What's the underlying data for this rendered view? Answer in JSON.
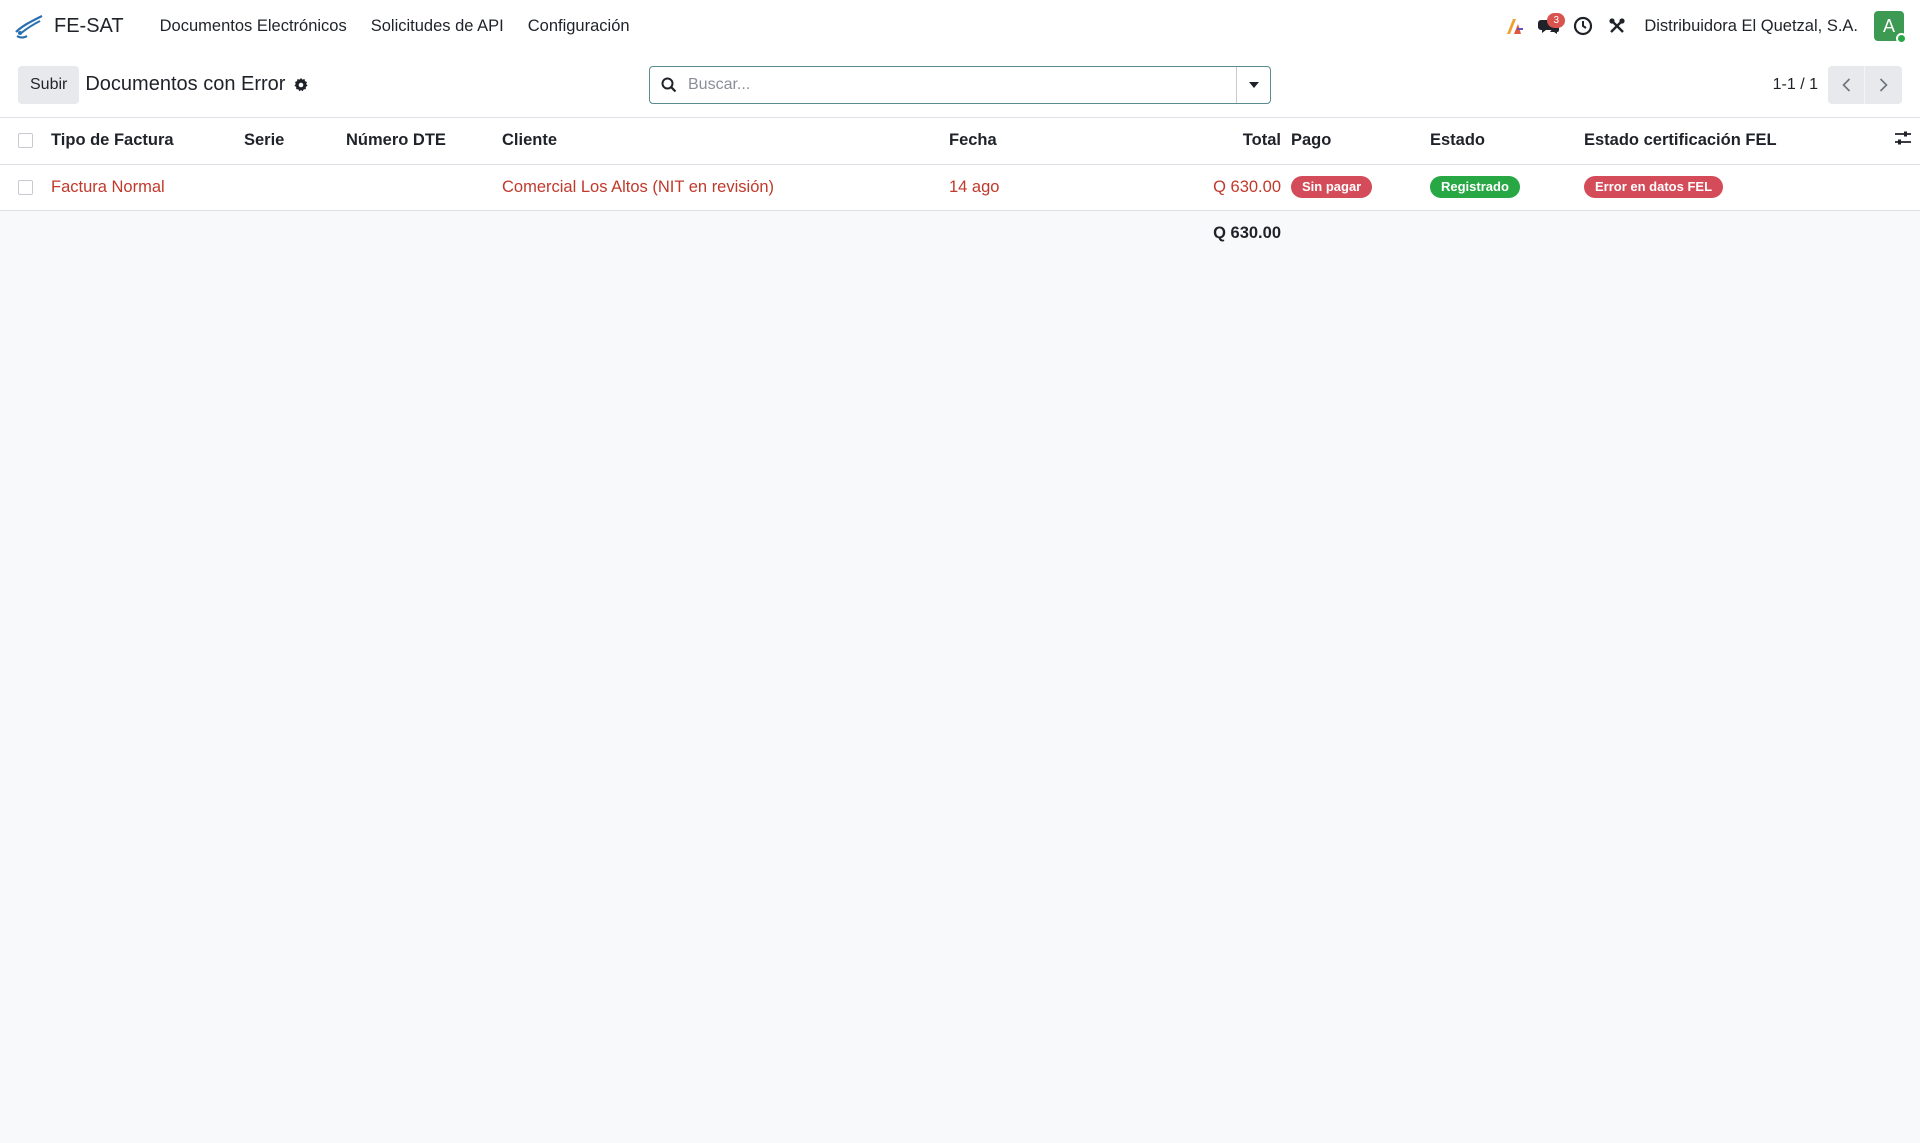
{
  "app": {
    "name": "FE-SAT"
  },
  "menu": [
    {
      "label": "Documentos Electrónicos"
    },
    {
      "label": "Solicitudes de API"
    },
    {
      "label": "Configuración"
    }
  ],
  "systray": {
    "messages_count": "3",
    "company": "Distribuidora El Quetzal, S.A.",
    "avatar_initial": "A"
  },
  "control": {
    "upload_label": "Subir",
    "title": "Documentos con Error",
    "search_placeholder": "Buscar...",
    "pager": "1-1 / 1"
  },
  "table": {
    "columns": {
      "tipo": "Tipo de Factura",
      "serie": "Serie",
      "numero": "Número DTE",
      "cliente": "Cliente",
      "fecha": "Fecha",
      "total": "Total",
      "pago": "Pago",
      "estado": "Estado",
      "fel": "Estado certificación FEL"
    },
    "rows": [
      {
        "tipo": "Factura Normal",
        "serie": "",
        "numero": "",
        "cliente": "Comercial Los Altos (NIT en revisión)",
        "fecha": "14 ago",
        "total": "Q 630.00",
        "pago": "Sin pagar",
        "estado": "Registrado",
        "fel": "Error en datos FEL"
      }
    ],
    "footer_total": "Q 630.00"
  },
  "colors": {
    "danger_text": "#c0392b",
    "badge_red": "#d44c59",
    "badge_green": "#28a745",
    "avatar": "#3d9a52"
  }
}
